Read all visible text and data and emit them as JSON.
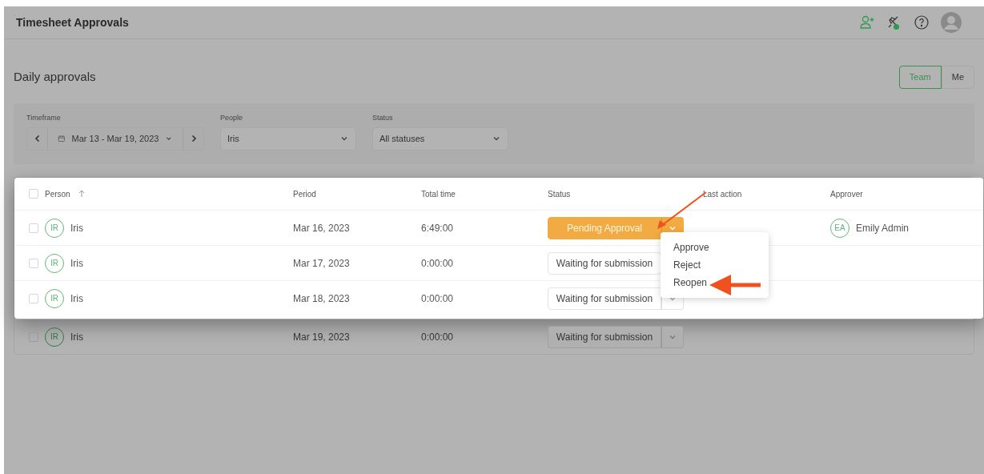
{
  "header": {
    "title": "Timesheet Approvals"
  },
  "section": {
    "title": "Daily approvals"
  },
  "view_toggle": [
    {
      "label": "Team",
      "selected": true
    },
    {
      "label": "Me",
      "selected": false
    }
  ],
  "filters": {
    "timeframe": {
      "label": "Timeframe",
      "value": "Mar 13 - Mar 19, 2023"
    },
    "people": {
      "label": "People",
      "value": "Iris"
    },
    "status": {
      "label": "Status",
      "value": "All statuses"
    }
  },
  "table": {
    "select_all_checked": false,
    "columns": [
      "Person",
      "Period",
      "Total time",
      "Status",
      "Last action",
      "Approver"
    ],
    "rows": [
      {
        "checked": false,
        "highlighted": true,
        "initials": "IR",
        "name": "Iris",
        "period": "Mar 16, 2023",
        "total_time": "6:49:00",
        "status": {
          "kind": "pending",
          "label": "Pending Approval"
        },
        "approver": {
          "initials": "EA",
          "name": "Emily Admin"
        }
      },
      {
        "checked": false,
        "highlighted": true,
        "initials": "IR",
        "name": "Iris",
        "period": "Mar 17, 2023",
        "total_time": "0:00:00",
        "status": {
          "kind": "waiting",
          "label": "Waiting for submission",
          "dropdown_visible": false
        }
      },
      {
        "checked": false,
        "highlighted": true,
        "initials": "IR",
        "name": "Iris",
        "period": "Mar 18, 2023",
        "total_time": "0:00:00",
        "status": {
          "kind": "waiting",
          "label": "Waiting for submission"
        }
      },
      {
        "checked": false,
        "highlighted": false,
        "initials": "IR",
        "name": "Iris",
        "period": "Mar 19, 2023",
        "total_time": "0:00:00",
        "status": {
          "kind": "waiting",
          "label": "Waiting for submission"
        }
      }
    ]
  },
  "status_menu": {
    "items": [
      "Approve",
      "Reject",
      "Reopen"
    ]
  }
}
